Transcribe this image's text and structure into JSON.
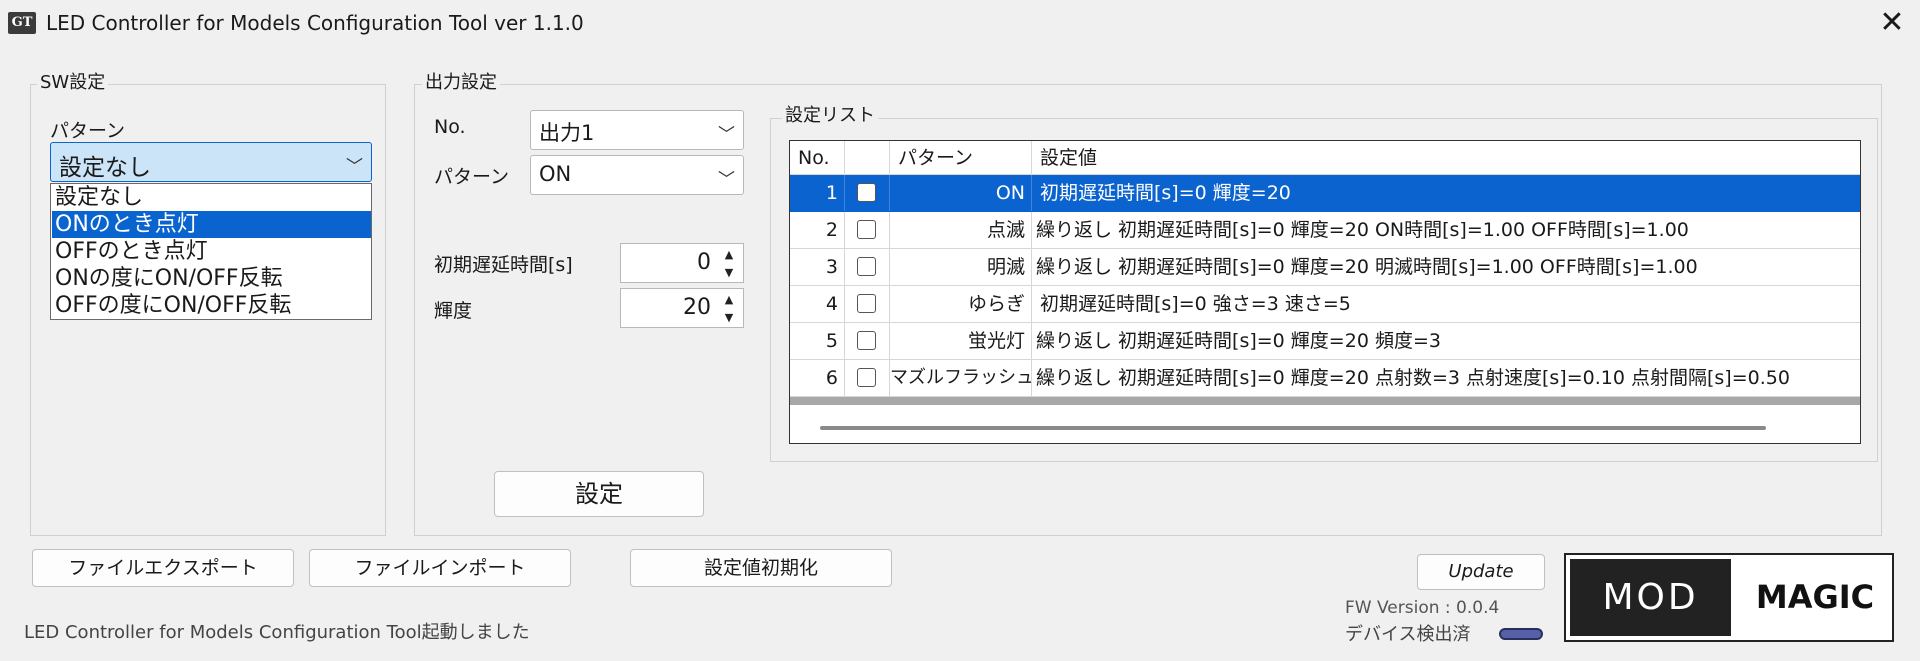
{
  "window": {
    "icon_text": "GT",
    "title": "LED Controller for Models Configuration Tool ver 1.1.0",
    "close_glyph": "✕"
  },
  "sw": {
    "group_label": "SW設定",
    "pattern_label": "パターン",
    "selected": "設定なし",
    "options": [
      "設定なし",
      "ONのとき点灯",
      "OFFのとき点灯",
      "ONの度にON/OFF反転",
      "OFFの度にON/OFF反転"
    ],
    "highlighted_index": 1
  },
  "output": {
    "group_label": "出力設定",
    "no_label": "No.",
    "no_value": "出力1",
    "pattern_label": "パターン",
    "pattern_value": "ON",
    "delay_label": "初期遅延時間[s]",
    "delay_value": "0",
    "brightness_label": "輝度",
    "brightness_value": "20",
    "apply_button": "設定"
  },
  "list": {
    "group_label": "設定リスト",
    "headers": [
      "No.",
      "",
      "パターン",
      "設定値"
    ],
    "rows": [
      {
        "no": "1",
        "pattern": "ON",
        "value": "初期遅延時間[s]=0 輝度=20",
        "selected": true
      },
      {
        "no": "2",
        "pattern": "点滅",
        "value": "繰り返し 初期遅延時間[s]=0 輝度=20 ON時間[s]=1.00 OFF時間[s]=1.00"
      },
      {
        "no": "3",
        "pattern": "明滅",
        "value": "繰り返し 初期遅延時間[s]=0 輝度=20 明滅時間[s]=1.00 OFF時間[s]=1.00"
      },
      {
        "no": "4",
        "pattern": "ゆらぎ",
        "value": "初期遅延時間[s]=0 強さ=3 速さ=5"
      },
      {
        "no": "5",
        "pattern": "蛍光灯",
        "value": "繰り返し 初期遅延時間[s]=0 輝度=20 頻度=3"
      },
      {
        "no": "6",
        "pattern": "マズルフラッシュ",
        "value": "繰り返し 初期遅延時間[s]=0 輝度=20 点射数=3 点射速度[s]=0.10 点射間隔[s]=0.50"
      }
    ]
  },
  "footer": {
    "export_button": "ファイルエクスポート",
    "import_button": "ファイルインポート",
    "reset_button": "設定値初期化",
    "update_button": "Update",
    "status": "LED Controller for Models Configuration Tool起動しました",
    "fw_version": "FW Version : 0.0.4",
    "device_status": "デバイス検出済"
  },
  "logo": {
    "left": "MOD",
    "right": "MAGIC"
  },
  "colors": {
    "selection": "#0b63cf",
    "window_bg": "#f0f0f0"
  }
}
